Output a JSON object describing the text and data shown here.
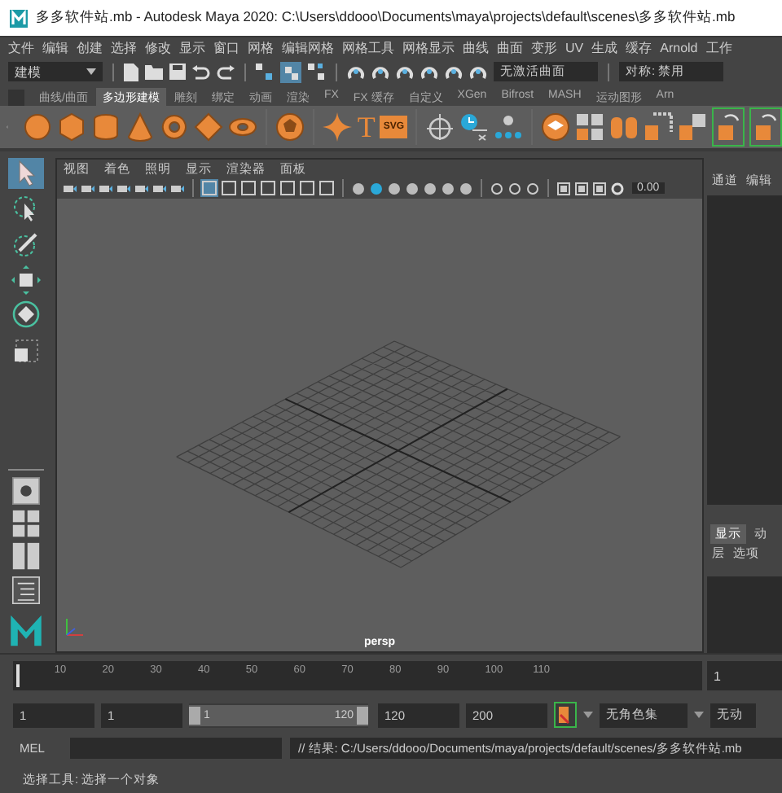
{
  "window": {
    "title": "多多软件站.mb - Autodesk Maya 2020: C:\\Users\\ddooo\\Documents\\maya\\projects\\default\\scenes\\多多软件站.mb"
  },
  "menubar": [
    "文件",
    "编辑",
    "创建",
    "选择",
    "修改",
    "显示",
    "窗口",
    "网格",
    "编辑网格",
    "网格工具",
    "网格显示",
    "曲线",
    "曲面",
    "变形",
    "UV",
    "生成",
    "缓存",
    "Arnold",
    "工作"
  ],
  "status_line": {
    "mode": "建模",
    "surface_field": "无激活曲面",
    "symmetry": "对称: 禁用"
  },
  "shelf": {
    "tabs": [
      {
        "label": "曲线/曲面",
        "selected": false
      },
      {
        "label": "多边形建模",
        "selected": true
      },
      {
        "label": "雕刻",
        "selected": false
      },
      {
        "label": "绑定",
        "selected": false
      },
      {
        "label": "动画",
        "selected": false
      },
      {
        "label": "渲染",
        "selected": false
      },
      {
        "label": "FX",
        "selected": false
      },
      {
        "label": "FX 缓存",
        "selected": false
      },
      {
        "label": "自定义",
        "selected": false
      },
      {
        "label": "XGen",
        "selected": false
      },
      {
        "label": "Bifrost",
        "selected": false
      },
      {
        "label": "MASH",
        "selected": false
      },
      {
        "label": "运动图形",
        "selected": false
      },
      {
        "label": "Arn",
        "selected": false
      }
    ],
    "type_tool_label": "T",
    "svg_tool_label": "SVG"
  },
  "toolbox": [
    {
      "kind": "select",
      "selected": true
    },
    {
      "kind": "lasso",
      "selected": false
    },
    {
      "kind": "paint",
      "selected": false
    },
    {
      "kind": "move",
      "selected": false
    },
    {
      "kind": "rotate",
      "selected": false
    },
    {
      "kind": "scale",
      "selected": false
    }
  ],
  "viewport": {
    "menus": [
      "视图",
      "着色",
      "照明",
      "显示",
      "渲染器",
      "面板"
    ],
    "camera_value": "0.00",
    "camera": "persp"
  },
  "channel_box": {
    "tabs": [
      "通道",
      "编辑"
    ],
    "layer_tabs": [
      {
        "label": "显示",
        "selected": true
      },
      {
        "label": "动",
        "selected": false
      }
    ],
    "layer_menus": [
      "层",
      "选项"
    ]
  },
  "time_slider": {
    "ticks": [
      "10",
      "20",
      "30",
      "40",
      "50",
      "60",
      "70",
      "80",
      "90",
      "100",
      "110"
    ],
    "current_frame": "1",
    "level": 0
  },
  "range_slider": {
    "start": "1",
    "playback_start": "1",
    "range_start": "1",
    "range_end": "120",
    "playback_end": "120",
    "end": "200",
    "character_set": "无角色集",
    "anim_layer": "无动",
    "level": 1
  },
  "command_line": {
    "language": "MEL",
    "result": "// 结果: C:/Users/ddooo/Documents/maya/projects/default/scenes/多多软件站.mb"
  },
  "help_line": "选择工具: 选择一个对象"
}
